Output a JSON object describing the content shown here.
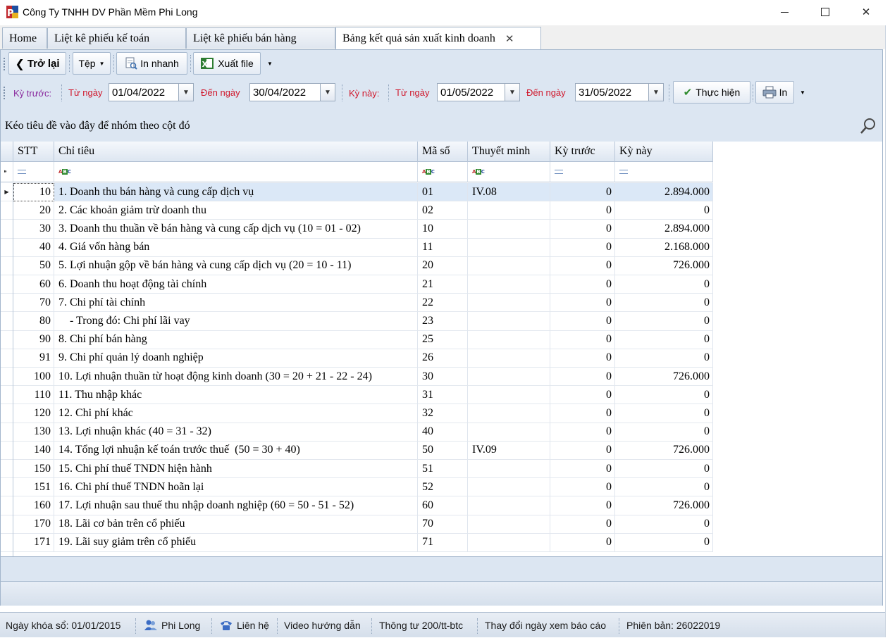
{
  "window": {
    "title": "Công Ty TNHH DV Phần Mềm Phi Long",
    "minimize": "—",
    "maximize": "☐",
    "close": "✕"
  },
  "tabs": [
    {
      "label": "Home"
    },
    {
      "label": "Liệt kê phiếu kế toán"
    },
    {
      "label": "Liệt kê phiếu bán hàng"
    },
    {
      "label": "Bảng kết quả sản xuất kinh doanh",
      "close": "✕"
    }
  ],
  "toolbar": {
    "back_label": "Trở lại",
    "file_label": "Tệp",
    "print_quick_label": "In nhanh",
    "export_label": "Xuất file"
  },
  "filter": {
    "prev_period_label": "Kỳ trước:",
    "from_date_label": "Từ ngày",
    "to_date_label": "Đến ngày",
    "prev_from": "01/04/2022",
    "prev_to": "30/04/2022",
    "this_period_label": "Kỳ này:",
    "cur_from": "01/05/2022",
    "cur_to": "31/05/2022",
    "run_label": "Thực hiện",
    "print_label": "In"
  },
  "group_panel_text": "Kéo tiêu đề vào đây để nhóm theo cột đó",
  "grid": {
    "columns": [
      "STT",
      "Chỉ tiêu",
      "Mã số",
      "Thuyết minh",
      "Kỳ trước",
      "Kỳ này"
    ],
    "rows": [
      {
        "stt": "10",
        "name": "1. Doanh thu bán hàng và cung cấp dịch vụ",
        "code": "01",
        "note": "IV.08",
        "prev": "0",
        "cur": "2.894.000"
      },
      {
        "stt": "20",
        "name": "2. Các khoản giảm trừ doanh thu",
        "code": "02",
        "note": "",
        "prev": "0",
        "cur": "0"
      },
      {
        "stt": "30",
        "name": "3. Doanh thu thuần về bán hàng và cung cấp dịch vụ (10 = 01 - 02)",
        "code": "10",
        "note": "",
        "prev": "0",
        "cur": "2.894.000"
      },
      {
        "stt": "40",
        "name": "4. Giá vốn hàng bán",
        "code": "11",
        "note": "",
        "prev": "0",
        "cur": "2.168.000"
      },
      {
        "stt": "50",
        "name": "5. Lợi nhuận gộp về bán hàng và cung cấp dịch vụ (20 = 10 - 11)",
        "code": "20",
        "note": "",
        "prev": "0",
        "cur": "726.000"
      },
      {
        "stt": "60",
        "name": "6. Doanh thu hoạt động tài chính",
        "code": "21",
        "note": "",
        "prev": "0",
        "cur": "0"
      },
      {
        "stt": "70",
        "name": "7. Chi phí tài chính",
        "code": "22",
        "note": "",
        "prev": "0",
        "cur": "0"
      },
      {
        "stt": "80",
        "name": "    - Trong đó: Chi phí lãi vay",
        "code": "23",
        "note": "",
        "prev": "0",
        "cur": "0"
      },
      {
        "stt": "90",
        "name": "8. Chi phí bán hàng",
        "code": "25",
        "note": "",
        "prev": "0",
        "cur": "0"
      },
      {
        "stt": "91",
        "name": "9. Chi phí quản lý doanh nghiệp",
        "code": "26",
        "note": "",
        "prev": "0",
        "cur": "0"
      },
      {
        "stt": "100",
        "name": "10. Lợi nhuận thuần từ hoạt động kinh doanh (30 = 20 + 21 - 22 - 24)",
        "code": "30",
        "note": "",
        "prev": "0",
        "cur": "726.000"
      },
      {
        "stt": "110",
        "name": "11. Thu nhập khác",
        "code": "31",
        "note": "",
        "prev": "0",
        "cur": "0"
      },
      {
        "stt": "120",
        "name": "12. Chi phí khác",
        "code": "32",
        "note": "",
        "prev": "0",
        "cur": "0"
      },
      {
        "stt": "130",
        "name": "13. Lợi nhuận khác (40 = 31 - 32)",
        "code": "40",
        "note": "",
        "prev": "0",
        "cur": "0"
      },
      {
        "stt": "140",
        "name": "14. Tổng lợi nhuận kế toán trước thuế  (50 = 30 + 40)",
        "code": "50",
        "note": "IV.09",
        "prev": "0",
        "cur": "726.000"
      },
      {
        "stt": "150",
        "name": "15. Chi phí thuế TNDN hiện hành",
        "code": "51",
        "note": "",
        "prev": "0",
        "cur": "0"
      },
      {
        "stt": "151",
        "name": "16. Chi phí thuế TNDN hoãn lại",
        "code": "52",
        "note": "",
        "prev": "0",
        "cur": "0"
      },
      {
        "stt": "160",
        "name": "17. Lợi nhuận sau thuế thu nhập doanh nghiệp (60 = 50 - 51 - 52)",
        "code": "60",
        "note": "",
        "prev": "0",
        "cur": "726.000"
      },
      {
        "stt": "170",
        "name": "18. Lãi cơ bản trên cổ phiếu",
        "code": "70",
        "note": "",
        "prev": "0",
        "cur": "0"
      },
      {
        "stt": "171",
        "name": "19. Lãi suy giảm trên cổ phiếu",
        "code": "71",
        "note": "",
        "prev": "0",
        "cur": "0"
      }
    ]
  },
  "statusbar": {
    "lock_date": "Ngày khóa sổ: 01/01/2015",
    "user": "Phi Long",
    "contact": "Liên hệ",
    "video": "Video hướng dẫn",
    "circular": "Thông tư 200/tt-btc",
    "change_date": "Thay đổi ngày xem báo cáo",
    "version": "Phiên bản: 26022019"
  },
  "colors": {
    "accent_red": "#d0182c",
    "accent_purple": "#8a2a9e",
    "panel_blue": "#dce6f2",
    "selected_row": "#dbe8f7"
  }
}
